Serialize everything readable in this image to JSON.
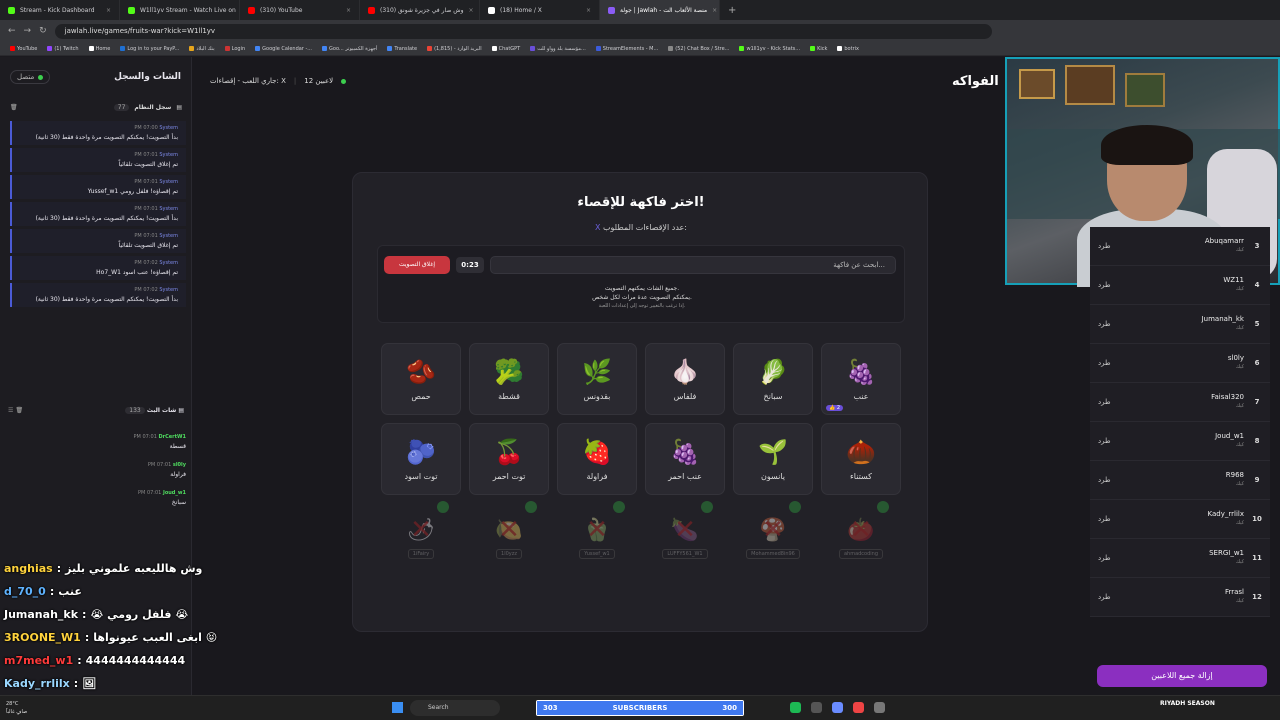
{
  "browser": {
    "tabs": [
      {
        "title": "Stream - Kick Dashboard",
        "color": "#53fc18",
        "active": false
      },
      {
        "title": "W1ll1yv Stream - Watch Live on",
        "color": "#53fc18",
        "active": false
      },
      {
        "title": "(310) YouTube",
        "color": "#ff0000",
        "active": false
      },
      {
        "title": "(310) وش صار في جزيرة شونق",
        "color": "#ff0000",
        "active": false
      },
      {
        "title": "(18) Home / X",
        "color": "#ffffff",
        "active": false
      },
      {
        "title": "جولة | Jawlah - منصة الألعاب الت",
        "color": "#8b5cf6",
        "active": true
      }
    ],
    "new_tab": "+",
    "url": "jawlah.live/games/fruits-war?kick=W1ll1yv",
    "bookmarks": [
      {
        "label": "YouTube",
        "color": "#ff0000"
      },
      {
        "label": "(1) Twitch",
        "color": "#9146ff"
      },
      {
        "label": "Home",
        "color": "#ffffff"
      },
      {
        "label": "Log in to your PayP...",
        "color": "#1f6fd1"
      },
      {
        "label": "بنك البلاد",
        "color": "#e6a51c"
      },
      {
        "label": "Login",
        "color": "#c33"
      },
      {
        "label": "Google Calendar -...",
        "color": "#4285f4"
      },
      {
        "label": "Goo... أجهزة الكمبيوتر",
        "color": "#4285f4"
      },
      {
        "label": "Translate",
        "color": "#4285f4"
      },
      {
        "label": "البريد الوارد - (1,815)",
        "color": "#ea4335"
      },
      {
        "label": "ChatGPT",
        "color": "#ffffff"
      },
      {
        "label": "مؤسسة بلد وواو للت...",
        "color": "#6a4fd8"
      },
      {
        "label": "StreamElements - M...",
        "color": "#3b5bdb"
      },
      {
        "label": "(52) Chat Box / Stre...",
        "color": "#888888"
      },
      {
        "label": "w1ll1yv - Kick Stats...",
        "color": "#53fc18"
      },
      {
        "label": "Kick",
        "color": "#53fc18"
      },
      {
        "label": "botrix",
        "color": "#ffffff"
      }
    ]
  },
  "left": {
    "title": "الشات والسجل",
    "status": "متصل",
    "system_log": {
      "title": "سجل النظام",
      "count": "77"
    },
    "system_messages": [
      {
        "time": "PM 07:00",
        "author": "System",
        "text": "بدأ التصويت! يمكنكم التصويت مرة واحدة فقط (30 ثانية)"
      },
      {
        "time": "PM 07:01",
        "author": "System",
        "text": "تم إغلاق التصويت تلقائياً"
      },
      {
        "time": "PM 07:01",
        "author": "System",
        "text": "Yussef_w1 تم إقصاؤه! فلفل رومي"
      },
      {
        "time": "PM 07:01",
        "author": "System",
        "text": "بدأ التصويت! يمكنكم التصويت مرة واحدة فقط (30 ثانية)"
      },
      {
        "time": "PM 07:01",
        "author": "System",
        "text": "تم إغلاق التصويت تلقائياً"
      },
      {
        "time": "PM 07:02",
        "author": "System",
        "text": "Ho7_W1 تم إقصاؤه! عنب اسود"
      },
      {
        "time": "PM 07:02",
        "author": "System",
        "text": "بدأ التصويت! يمكنكم التصويت مرة واحدة فقط (30 ثانية)"
      }
    ],
    "live_chat": {
      "title": "شات البث",
      "count": "133"
    },
    "chat_messages": [
      {
        "time": "PM 07:01",
        "user": "DrCertW1",
        "text": "قسطة"
      },
      {
        "time": "PM 07:01",
        "user": "sl0ly",
        "text": "فراولة"
      },
      {
        "time": "PM 07:01",
        "user": "Joud_w1",
        "text": "سبانخ"
      }
    ]
  },
  "overlay_chat": [
    {
      "user": "anghias",
      "text": "وش هالليعبه علموني بليز"
    },
    {
      "user": "d_70_0",
      "text": "عنب"
    },
    {
      "user": "Jumanah_kk",
      "text": "😭 فلفل رومي 😭"
    },
    {
      "user": "3ROONE_W1",
      "text": "ابغى العبب عيونواها 😝"
    },
    {
      "user": "m7med_w1",
      "text": "4444444444444"
    },
    {
      "user": "Kady_rrlilx",
      "text": "🖼"
    }
  ],
  "header": {
    "page_title": "الفواكه",
    "players_online": "12 لاعبين",
    "status": "جاري اللعب - إقصاءات: X"
  },
  "game": {
    "title": "اختر فاكهة للإقصاء!",
    "subtitle": "عدد الإقصاءات المطلوب:",
    "subtitle_value": "X",
    "search_placeholder": "ابحث عن فاكهة...",
    "timer": "0:23",
    "close_vote_label": "إغلاق التصويت",
    "note_line1": "جميع الشات يمكنهم التصويت.",
    "note_line2": "يمكنكم التصويت عدة مرات لكل شخص.",
    "note_line3": "إذا ترغب بالتغيير توجه إلى إعدادات اللعبة.",
    "fruits": [
      {
        "name": "عنب",
        "emoji": "🍇",
        "votes": "2 👍"
      },
      {
        "name": "سبانخ",
        "emoji": "🥬",
        "votes": ""
      },
      {
        "name": "فلفاس",
        "emoji": "🧄",
        "votes": ""
      },
      {
        "name": "بقدونس",
        "emoji": "🌿",
        "votes": ""
      },
      {
        "name": "قشطة",
        "emoji": "🥦",
        "votes": ""
      },
      {
        "name": "حمص",
        "emoji": "🫘",
        "votes": ""
      },
      {
        "name": "كستناء",
        "emoji": "🌰",
        "votes": ""
      },
      {
        "name": "يانسون",
        "emoji": "🌱",
        "votes": ""
      },
      {
        "name": "عنب احمر",
        "emoji": "🍇",
        "votes": ""
      },
      {
        "name": "فراولة",
        "emoji": "🍓",
        "votes": ""
      },
      {
        "name": "توت احمر",
        "emoji": "🍒",
        "votes": ""
      },
      {
        "name": "توت اسود",
        "emoji": "🫐",
        "votes": ""
      }
    ],
    "eliminated": [
      {
        "emoji": "🍅",
        "player": "ahmadcoding"
      },
      {
        "emoji": "🍄",
        "player": "Mohammed8in96"
      },
      {
        "emoji": "🍆",
        "player": "LUFFY561_W1"
      },
      {
        "emoji": "🫑",
        "player": "Yussef_w1"
      },
      {
        "emoji": "🍋",
        "player": "1l0yzz"
      },
      {
        "emoji": "🌶",
        "player": "1iFairy"
      }
    ]
  },
  "players": [
    {
      "rank": "3",
      "name": "Abuqamarr",
      "sub": "كيك",
      "kick_label": "طرد"
    },
    {
      "rank": "4",
      "name": "WZ11",
      "sub": "كيك",
      "kick_label": "طرد"
    },
    {
      "rank": "5",
      "name": "Jumanah_kk",
      "sub": "كيك",
      "kick_label": "طرد"
    },
    {
      "rank": "6",
      "name": "sl0ly",
      "sub": "كيك",
      "kick_label": "طرد"
    },
    {
      "rank": "7",
      "name": "Faisal320",
      "sub": "كيك",
      "kick_label": "طرد"
    },
    {
      "rank": "8",
      "name": "Joud_w1",
      "sub": "كيك",
      "kick_label": "طرد"
    },
    {
      "rank": "9",
      "name": "R968",
      "sub": "كيك",
      "kick_label": "طرد"
    },
    {
      "rank": "10",
      "name": "Kady_rrlilx",
      "sub": "كيك",
      "kick_label": "طرد"
    },
    {
      "rank": "11",
      "name": "SERGI_w1",
      "sub": "كيك",
      "kick_label": "طرد"
    },
    {
      "rank": "12",
      "name": "Frrasl",
      "sub": "كيك",
      "kick_label": "طرد"
    }
  ],
  "remove_all_label": "إزالة جميع اللاعبين",
  "taskbar": {
    "weather_temp": "28°C",
    "weather_desc": "صافٍ غالباً",
    "search_label": "Search",
    "subs_current": "303",
    "subs_label": "SUBSCRIBERS",
    "subs_goal": "300",
    "subs_progress": 1.0,
    "season_label": "RIYADH SEASON"
  }
}
